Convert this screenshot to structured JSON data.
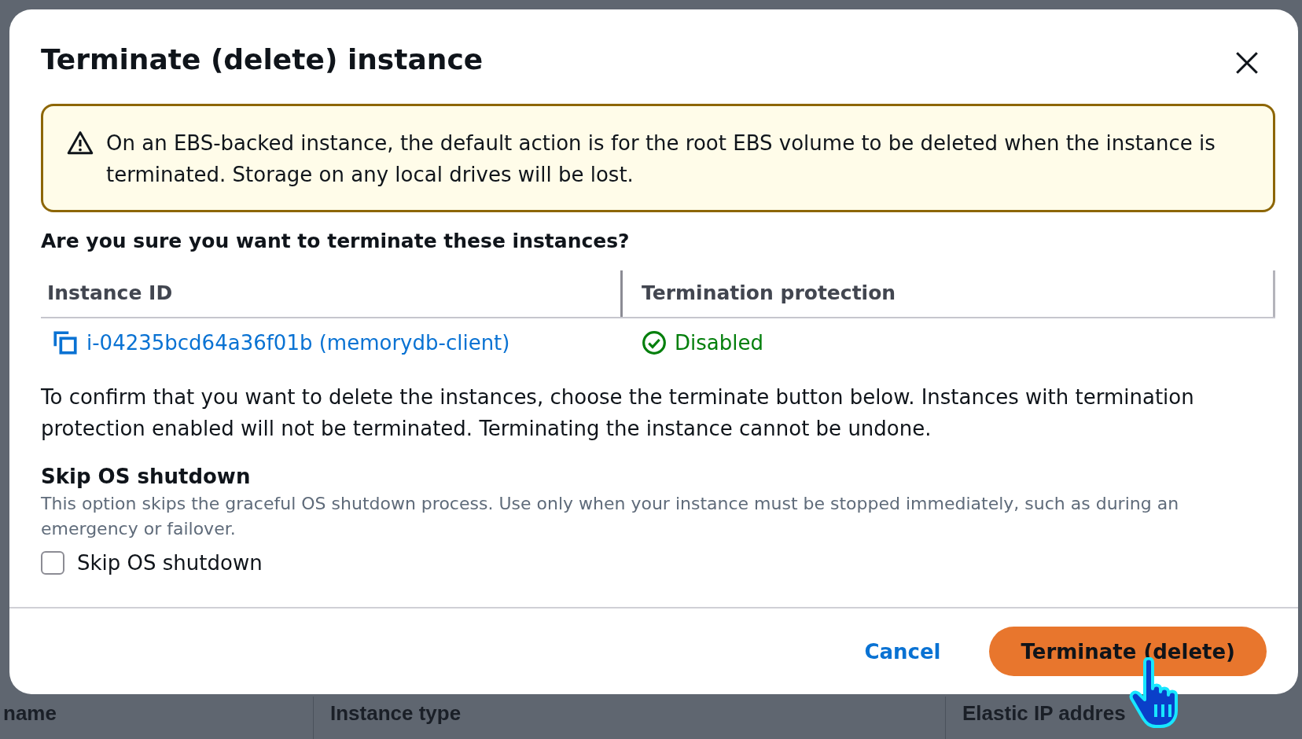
{
  "background": {
    "table_headers": [
      "name",
      "Instance type",
      "Elastic IP addres"
    ]
  },
  "dialog": {
    "title": "Terminate (delete) instance",
    "warning": "On an EBS-backed instance, the default action is for the root EBS volume to be deleted when the instance is terminated. Storage on any local drives will be lost.",
    "question": "Are you sure you want to terminate these instances?",
    "table": {
      "columns": [
        "Instance ID",
        "Termination protection"
      ],
      "rows": [
        {
          "instance": "i-04235bcd64a36f01b (memorydb-client)",
          "protection": "Disabled"
        }
      ]
    },
    "confirm_text": "To confirm that you want to delete the instances, choose the terminate button below. Instances with termination protection enabled will not be terminated. Terminating the instance cannot be undone.",
    "skip": {
      "heading": "Skip OS shutdown",
      "description": "This option skips the graceful OS shutdown process. Use only when your instance must be stopped immediately, such as during an emergency or failover.",
      "checkbox_label": "Skip OS shutdown",
      "checked": false
    },
    "buttons": [
      {
        "label": "Cancel",
        "kind": "link"
      },
      {
        "label": "Terminate (delete)",
        "kind": "primary"
      }
    ]
  }
}
